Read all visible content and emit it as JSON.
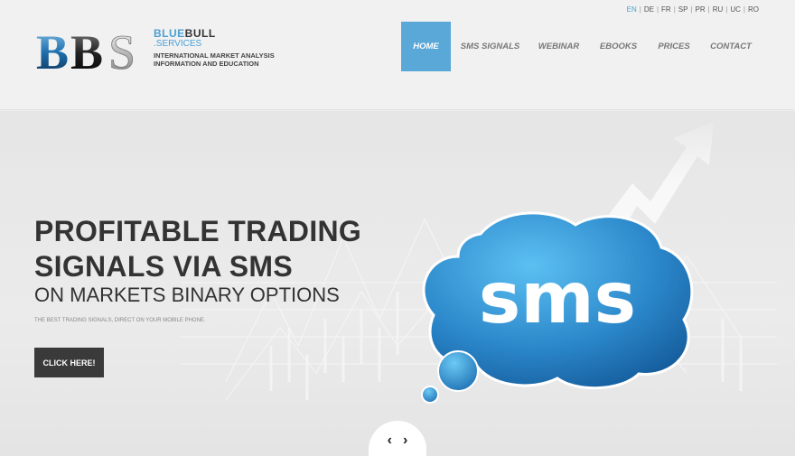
{
  "languages": [
    "EN",
    "DE",
    "FR",
    "SP",
    "PR",
    "RU",
    "UC",
    "RO"
  ],
  "active_language": "EN",
  "logo": {
    "mark": "BBS",
    "line1_a": "BLUE",
    "line1_b": "BULL",
    "line2": ".SERVICES",
    "line3": "INTERNATIONAL MARKET ANALYSIS",
    "line4": "INFORMATION AND EDUCATION"
  },
  "nav": [
    {
      "label": "HOME",
      "active": true
    },
    {
      "label": "SMS SIGNALS",
      "active": false
    },
    {
      "label": "WEBINAR",
      "active": false
    },
    {
      "label": "EBOOKS",
      "active": false
    },
    {
      "label": "PRICES",
      "active": false
    },
    {
      "label": "CONTACT",
      "active": false
    }
  ],
  "hero": {
    "headline1": "PROFITABLE TRADING",
    "headline2": "SIGNALS VIA SMS",
    "headline3": "ON MARKETS BINARY OPTIONS",
    "tagline": "THE BEST TRADING SIGNALS, DIRECT ON YOUR MOBILE PHONE.",
    "cta": "CLICK HERE!",
    "bubble_text": "sms"
  },
  "slider": {
    "prev": "‹",
    "next": "›"
  },
  "colors": {
    "accent": "#4aa0d5",
    "nav_active": "#5aa8d8",
    "cta_bg": "#3a3a3a",
    "bubble": "#2a86c9"
  }
}
